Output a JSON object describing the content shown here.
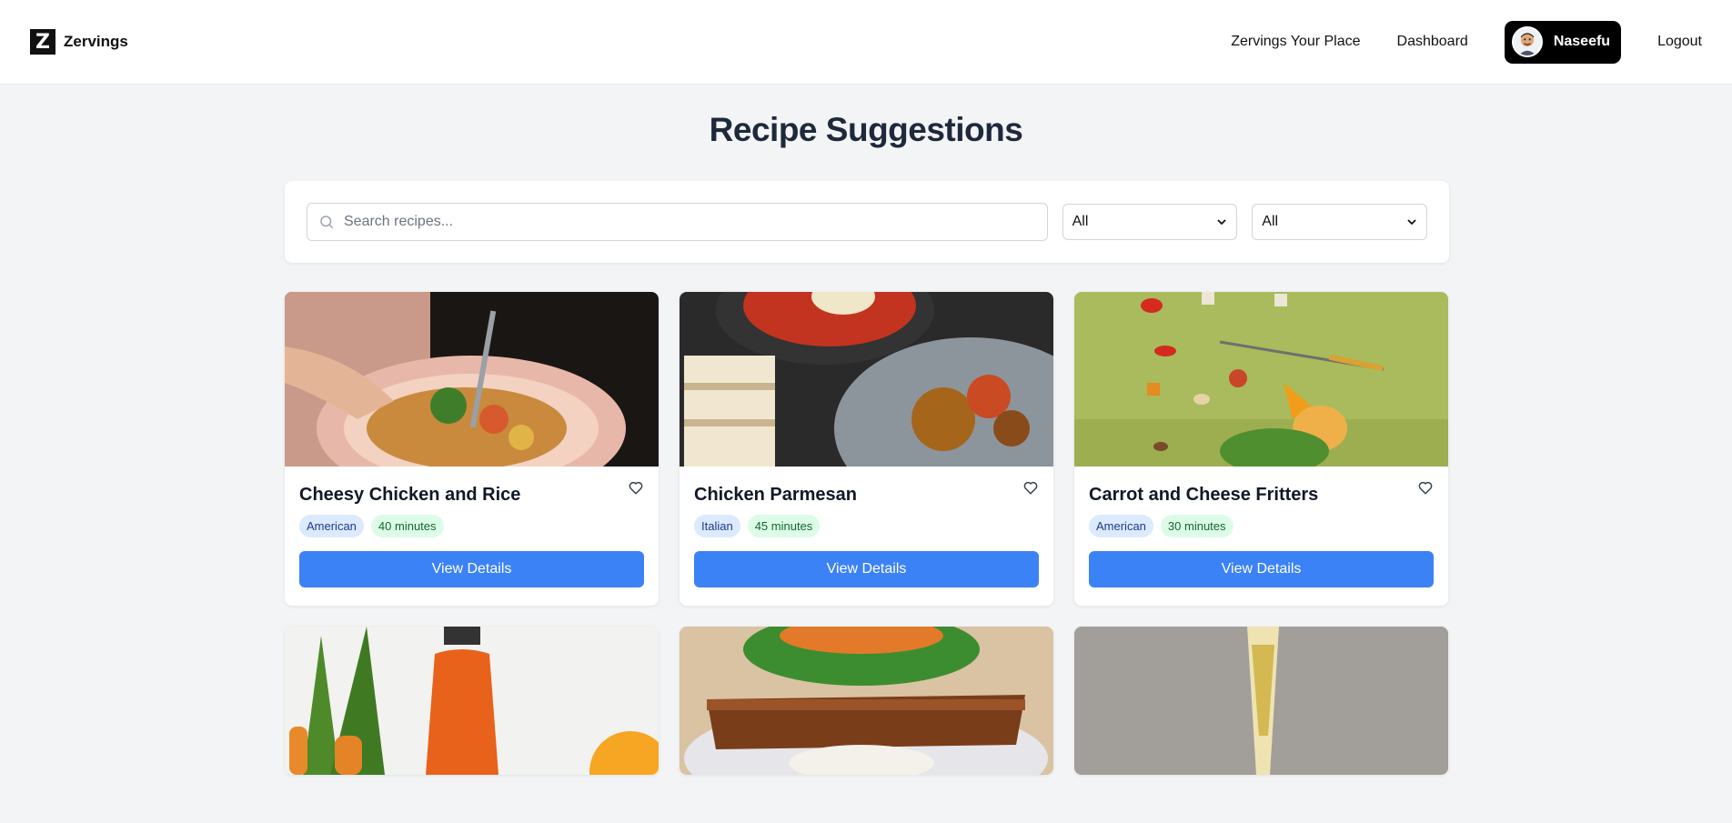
{
  "nav": {
    "brand_letter": "Z",
    "brand_name": "Zervings",
    "links": [
      "Zervings Your Place",
      "Dashboard"
    ],
    "user_name": "Naseefu",
    "logout": "Logout"
  },
  "page": {
    "title": "Recipe Suggestions"
  },
  "filters": {
    "search_placeholder": "Search recipes...",
    "cuisine_selected": "All",
    "time_selected": "All"
  },
  "recipes": [
    {
      "title": "Cheesy Chicken and Rice",
      "cuisine": "American",
      "time": "40 minutes",
      "button": "View Details"
    },
    {
      "title": "Chicken Parmesan",
      "cuisine": "Italian",
      "time": "45 minutes",
      "button": "View Details"
    },
    {
      "title": "Carrot and Cheese Fritters",
      "cuisine": "American",
      "time": "30 minutes",
      "button": "View Details"
    }
  ],
  "colors": {
    "accent": "#3b82f6",
    "background": "#f3f4f6"
  },
  "icons": [
    "search-icon",
    "heart-icon",
    "chevron-down-icon",
    "avatar"
  ]
}
